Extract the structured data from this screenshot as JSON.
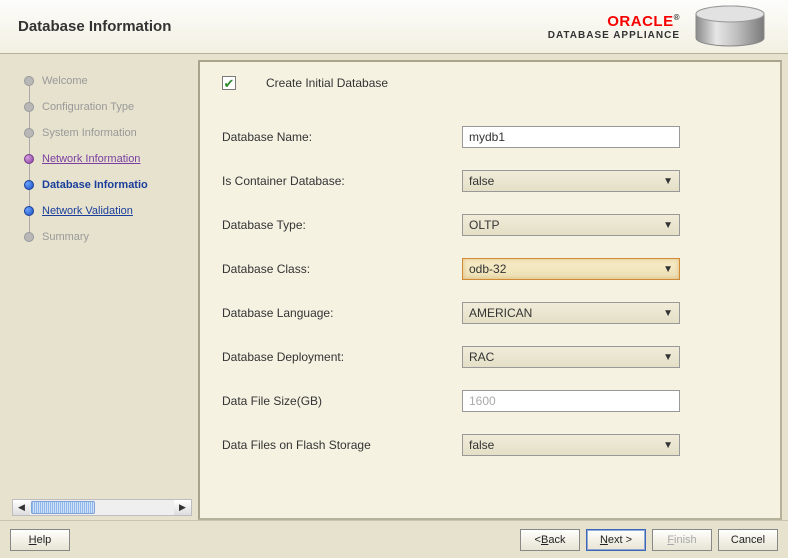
{
  "header": {
    "title": "Database Information",
    "brand_main": "ORACLE",
    "brand_sub": "DATABASE APPLIANCE"
  },
  "sidebar": {
    "steps": [
      {
        "label": "Welcome",
        "state": "inactive"
      },
      {
        "label": "Configuration Type",
        "state": "inactive"
      },
      {
        "label": "System Information",
        "state": "inactive"
      },
      {
        "label": "Network Information",
        "state": "done"
      },
      {
        "label": "Database Informatio",
        "state": "current"
      },
      {
        "label": "Network Validation",
        "state": "future"
      },
      {
        "label": "Summary",
        "state": "inactive"
      }
    ]
  },
  "form": {
    "create_initial_label": "Create Initial Database",
    "create_initial_checked": true,
    "fields": {
      "db_name": {
        "label": "Database Name:",
        "value": "mydb1"
      },
      "is_container": {
        "label": "Is Container Database:",
        "value": "false"
      },
      "db_type": {
        "label": "Database Type:",
        "value": "OLTP"
      },
      "db_class": {
        "label": "Database Class:",
        "value": "odb-32"
      },
      "db_language": {
        "label": "Database Language:",
        "value": "AMERICAN"
      },
      "db_deploy": {
        "label": "Database Deployment:",
        "value": "RAC"
      },
      "data_file_size": {
        "label": "Data File Size(GB)",
        "value": "1600"
      },
      "data_on_flash": {
        "label": "Data Files on Flash Storage",
        "value": "false"
      }
    }
  },
  "footer": {
    "help": "Help",
    "back": "Back",
    "next": "Next >",
    "finish": "Finish",
    "cancel": "Cancel"
  }
}
